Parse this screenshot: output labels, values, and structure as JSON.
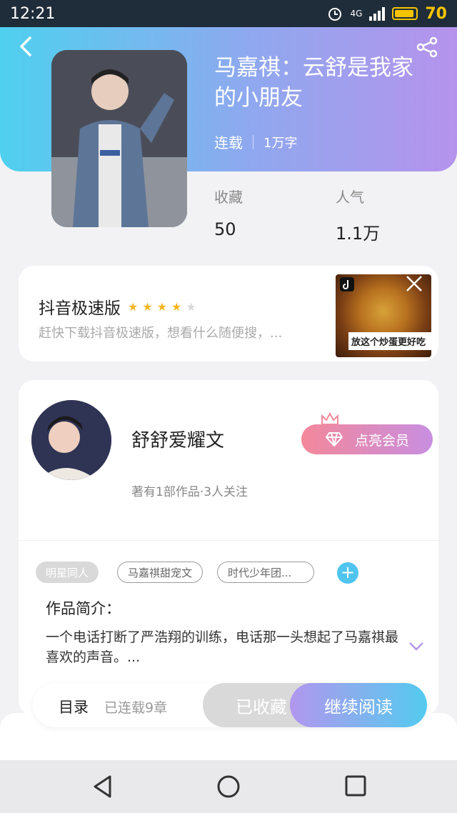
{
  "status_bar": {
    "time": "12:21",
    "network": "4G",
    "battery": "70"
  },
  "book": {
    "title": "马嘉祺：云舒是我家的小朋友",
    "status": "连载",
    "word_count": "1万字",
    "stats": [
      {
        "label": "收藏",
        "value": "50"
      },
      {
        "label": "人气",
        "value": "1.1万"
      }
    ]
  },
  "ad": {
    "title": "抖音极速版",
    "rating": 4,
    "max_rating": 5,
    "description": "赶快下载抖音极速版，想看什么随便搜，...",
    "thumb_caption": "放这个炒蛋更好吃"
  },
  "author": {
    "name": "舒舒爱耀文",
    "info": "著有1部作品·3人关注",
    "vip_button": "点亮会员"
  },
  "tags": [
    "明星同人",
    "马嘉祺甜宠文",
    "时代少年团..."
  ],
  "intro": {
    "label": "作品简介：",
    "text": "一个电话打断了严浩翔的训练，电话那一头想起了马嘉祺最喜欢的声音。..."
  },
  "action_bar": {
    "toc_label": "目录",
    "toc_count": "已连载9章",
    "collected_label": "已收藏",
    "read_label": "继续阅读"
  },
  "colors": {
    "header_gradient_start": "#4fd0ef",
    "header_gradient_end": "#b593ec",
    "read_button_start": "#b297ee",
    "read_button_end": "#53cbef",
    "vip_start": "#f3889a",
    "vip_end": "#c88ee0"
  }
}
